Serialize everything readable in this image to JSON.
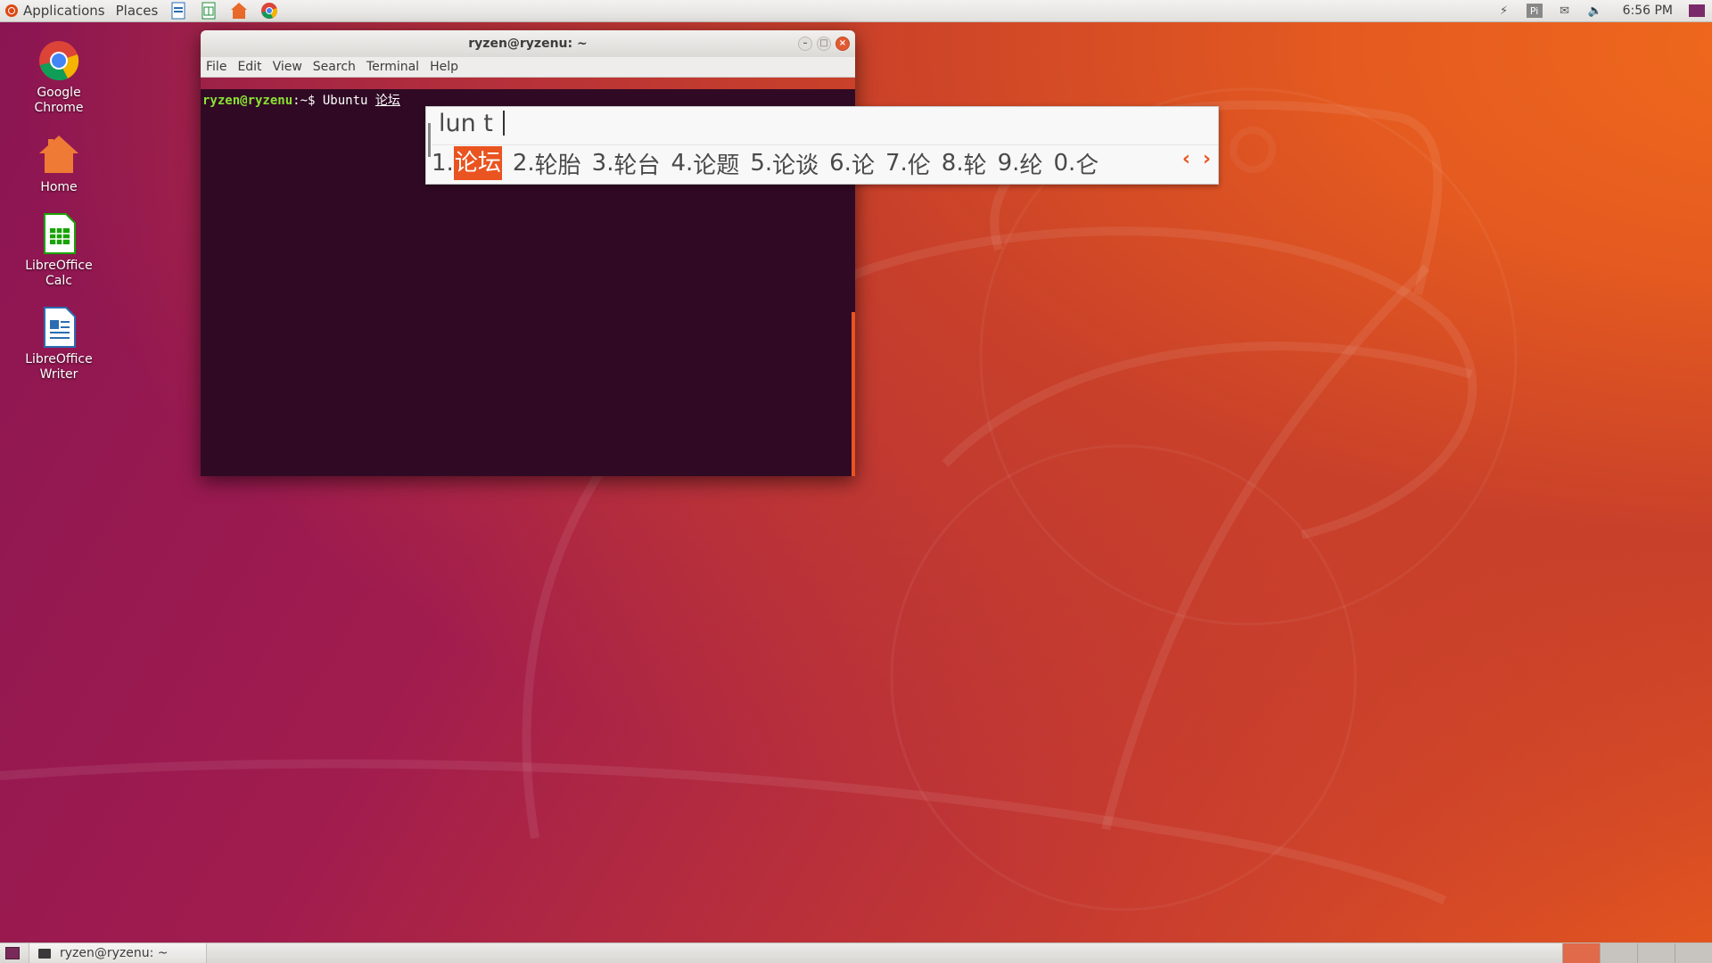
{
  "top_panel": {
    "applications_label": "Applications",
    "places_label": "Places",
    "clock": "6:56 PM"
  },
  "desktop_icons": [
    {
      "label": "Google Chrome",
      "icon": "chrome-icon"
    },
    {
      "label": "Home",
      "icon": "home-folder-icon"
    },
    {
      "label": "LibreOffice Calc",
      "icon": "libreoffice-calc-icon"
    },
    {
      "label": "LibreOffice Writer",
      "icon": "libreoffice-writer-icon"
    }
  ],
  "terminal": {
    "title": "ryzen@ryzenu: ~",
    "menu": [
      "File",
      "Edit",
      "View",
      "Search",
      "Terminal",
      "Help"
    ],
    "prompt_user": "ryzen@ryzenu",
    "prompt_path": ":~$",
    "command": " Ubuntu ",
    "preedit": "论坛"
  },
  "ime": {
    "preedit": "lun t",
    "candidates": [
      {
        "num": "1.",
        "text": "论坛",
        "selected": true
      },
      {
        "num": "2.",
        "text": "轮胎"
      },
      {
        "num": "3.",
        "text": "轮台"
      },
      {
        "num": "4.",
        "text": "论题"
      },
      {
        "num": "5.",
        "text": "论谈"
      },
      {
        "num": "6.",
        "text": "论"
      },
      {
        "num": "7.",
        "text": "伦"
      },
      {
        "num": "8.",
        "text": "轮"
      },
      {
        "num": "9.",
        "text": "纶"
      },
      {
        "num": "0.",
        "text": "仑"
      }
    ],
    "prev_symbol": "‹",
    "next_symbol": "›"
  },
  "bottom_panel": {
    "task_label": "ryzen@ryzenu: ~"
  },
  "colors": {
    "accent": "#e95420",
    "terminal_bg": "#300a24",
    "prompt_user": "#8ae234",
    "prompt_path": "#729fcf"
  }
}
